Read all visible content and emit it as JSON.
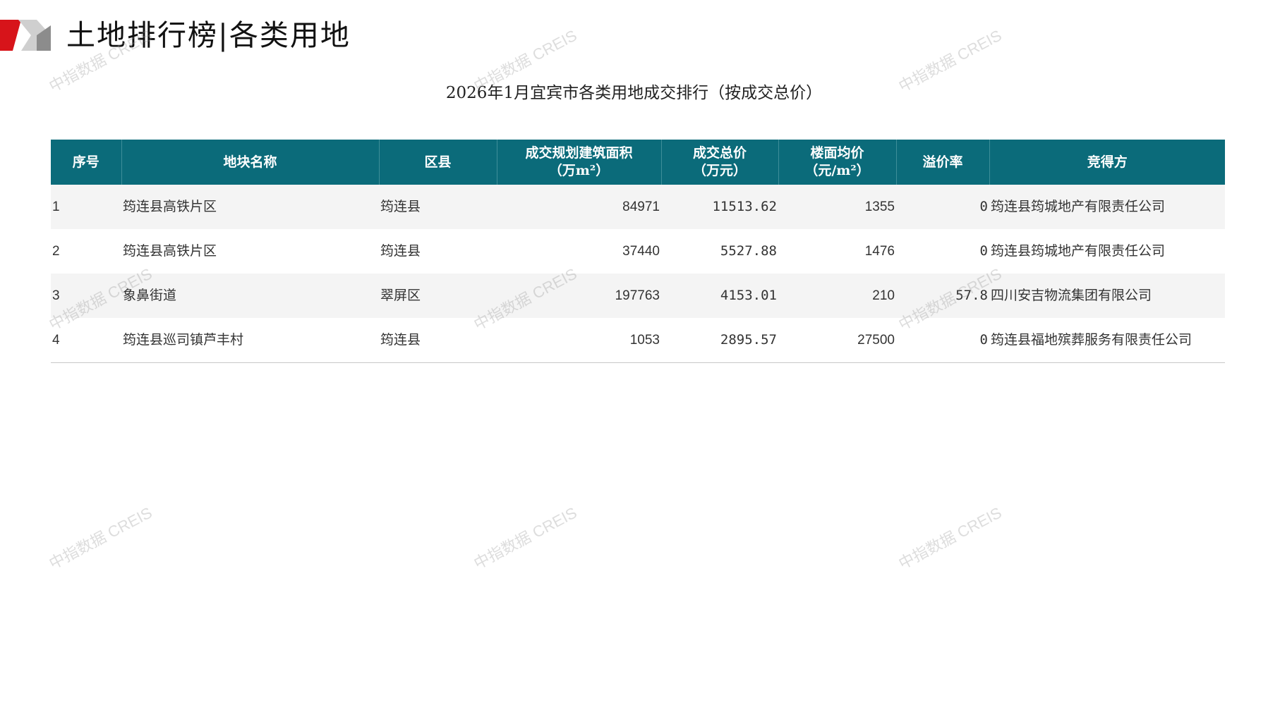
{
  "header": {
    "title": "土地排行榜|各类用地"
  },
  "table_title": "2026年1月宜宾市各类用地成交排行（按成交总价）",
  "table": {
    "columns": [
      {
        "label": "序号"
      },
      {
        "label": "地块名称"
      },
      {
        "label": "区县"
      },
      {
        "label": "成交规划建筑面积",
        "unit": "（万m²）"
      },
      {
        "label": "成交总价",
        "unit": "（万元）"
      },
      {
        "label": "楼面均价",
        "unit": "（元/m²）"
      },
      {
        "label": "溢价率"
      },
      {
        "label": "竞得方"
      }
    ],
    "rows": [
      {
        "index": "1",
        "name": "筠连县高铁片区",
        "district": "筠连县",
        "area": "84971",
        "total_price": "11513.62",
        "floor_price": "1355",
        "premium": "0",
        "buyer": "筠连县筠城地产有限责任公司"
      },
      {
        "index": "2",
        "name": "筠连县高铁片区",
        "district": "筠连县",
        "area": "37440",
        "total_price": "5527.88",
        "floor_price": "1476",
        "premium": "0",
        "buyer": "筠连县筠城地产有限责任公司"
      },
      {
        "index": "3",
        "name": "象鼻街道",
        "district": "翠屏区",
        "area": "197763",
        "total_price": "4153.01",
        "floor_price": "210",
        "premium": "57.8",
        "buyer": "四川安吉物流集团有限公司"
      },
      {
        "index": "4",
        "name": "筠连县巡司镇芦丰村",
        "district": "筠连县",
        "area": "1053",
        "total_price": "2895.57",
        "floor_price": "27500",
        "premium": "0",
        "buyer": "筠连县福地殡葬服务有限责任公司"
      }
    ]
  },
  "watermark": "中指数据 CREIS",
  "colors": {
    "header_bg": "#0b6b7a",
    "price_text": "#c00000",
    "logo_red": "#d7141a",
    "logo_gray": "#9a9a9a"
  }
}
